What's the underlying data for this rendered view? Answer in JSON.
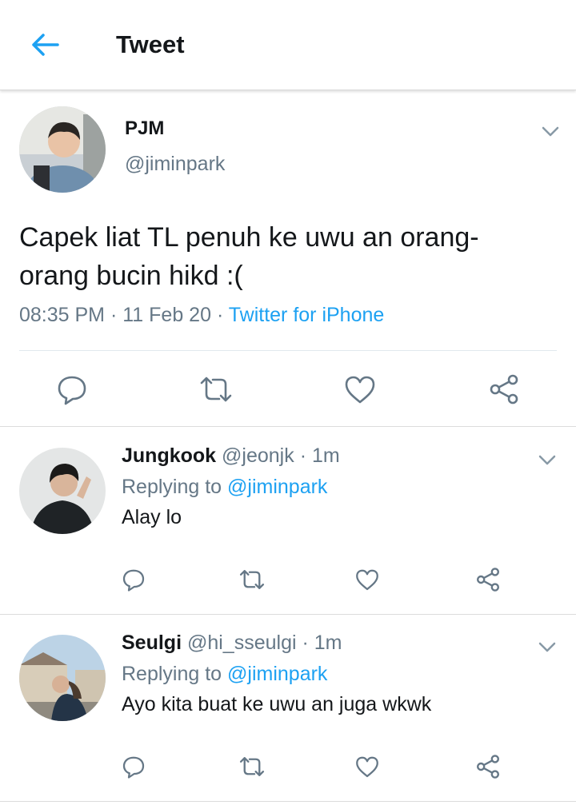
{
  "header": {
    "back_icon": "arrow-left-icon",
    "title": "Tweet"
  },
  "main_tweet": {
    "name": "PJM",
    "handle": "@jiminpark",
    "text": "Capek liat TL penuh ke uwu an orang-orang bucin hikd :(",
    "time": "08:35 PM",
    "date": "11 Feb 20",
    "source": "Twitter for iPhone",
    "dot": "·",
    "actions": [
      "reply-icon",
      "retweet-icon",
      "like-icon",
      "share-icon"
    ]
  },
  "replies": [
    {
      "name": "Jungkook",
      "handle": "@jeonjk",
      "dot": "·",
      "time": "1m",
      "replying_prefix": "Replying to",
      "replying_to": "@jiminpark",
      "text": "Alay lo"
    },
    {
      "name": "Seulgi",
      "handle": "@hi_sseulgi",
      "dot": "·",
      "time": "1m",
      "replying_prefix": "Replying to",
      "replying_to": "@jiminpark",
      "text": "Ayo kita buat ke uwu an juga wkwk"
    }
  ],
  "colors": {
    "accent": "#1da1f2",
    "secondary_text": "#657786",
    "primary_text": "#14171a",
    "icon_gray": "#657786"
  }
}
